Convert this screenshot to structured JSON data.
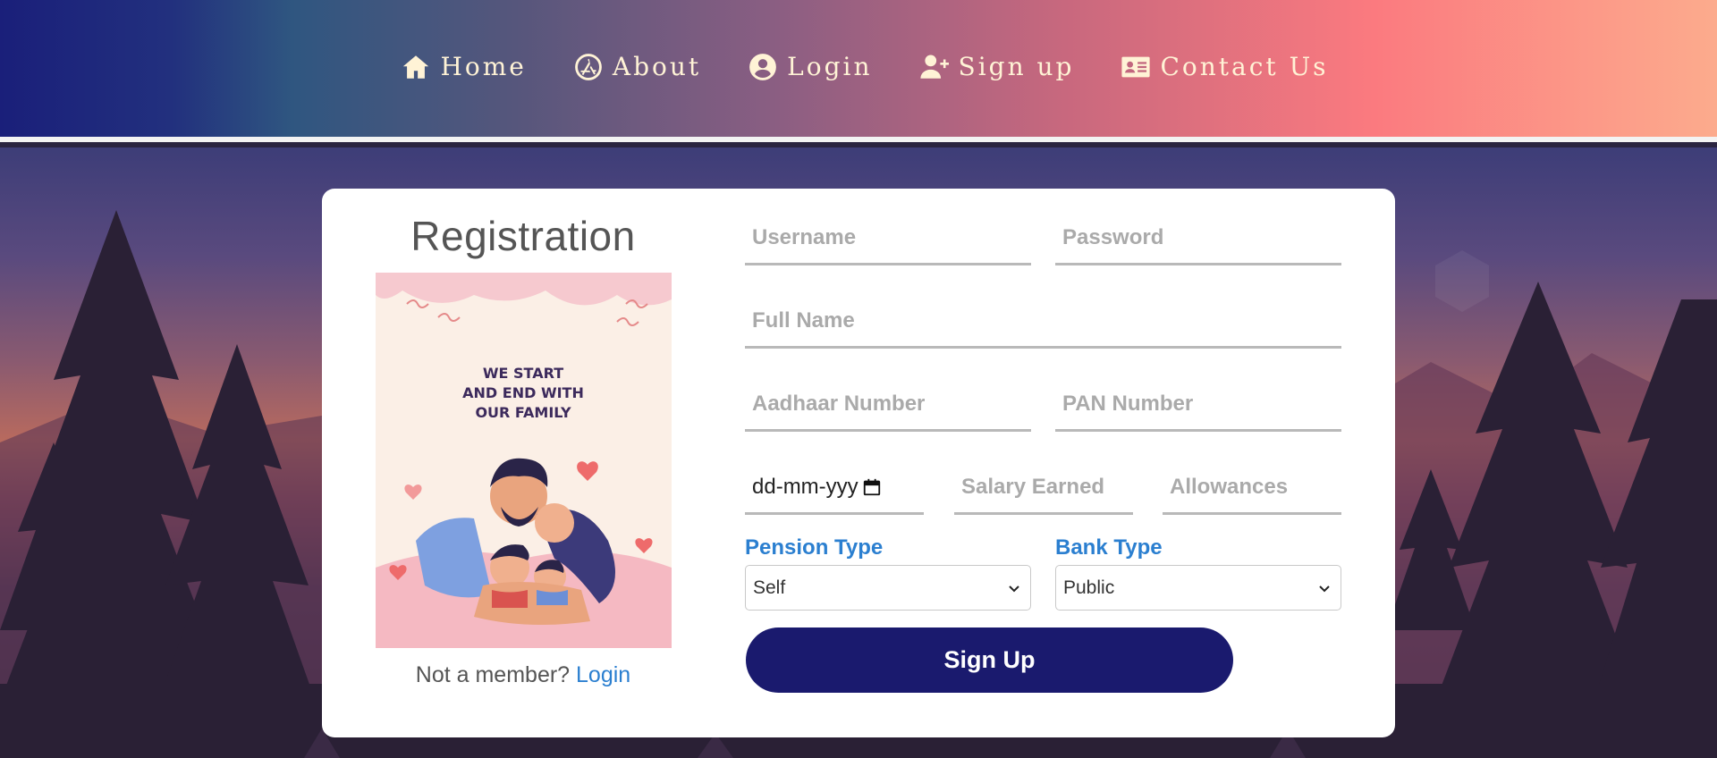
{
  "nav": {
    "items": [
      {
        "label": "Home",
        "icon": "home-icon"
      },
      {
        "label": "About",
        "icon": "app-store-icon"
      },
      {
        "label": "Login",
        "icon": "user-circle-icon"
      },
      {
        "label": "Sign up",
        "icon": "user-plus-icon"
      },
      {
        "label": "Contact Us",
        "icon": "id-card-icon"
      }
    ]
  },
  "form": {
    "title": "Registration",
    "poster": {
      "text_line1": "WE START",
      "text_line2": "AND END WITH",
      "text_line3": "OUR FAMILY"
    },
    "member_prompt": "Not a member?",
    "login_link": "Login",
    "username_placeholder": "Username",
    "password_placeholder": "Password",
    "fullname_placeholder": "Full Name",
    "aadhaar_placeholder": "Aadhaar Number",
    "pan_placeholder": "PAN Number",
    "date_placeholder": "dd-mm-yyy",
    "salary_placeholder": "Salary Earned",
    "allowances_placeholder": "Allowances",
    "pension_label": "Pension Type",
    "pension_value": "Self",
    "bank_label": "Bank Type",
    "bank_value": "Public",
    "submit_label": "Sign Up"
  },
  "colors": {
    "accent_blue": "#2b7fd0",
    "button_navy": "#1a1a6e",
    "nav_text": "#fff3d6"
  }
}
